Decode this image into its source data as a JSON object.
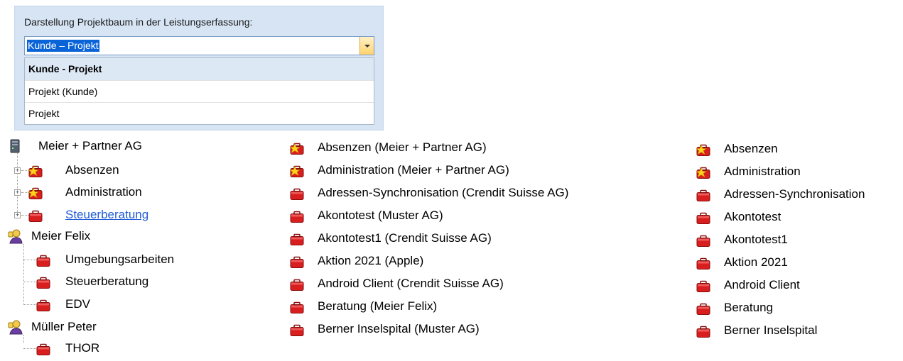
{
  "combo": {
    "label": "Darstellung Projektbaum in der Leistungserfassung:",
    "value": "Kunde – Projekt",
    "options": [
      "Kunde - Projekt",
      "Projekt (Kunde)",
      "Projekt"
    ]
  },
  "tree": {
    "root": "Meier + Partner AG",
    "root_children": [
      "Absenzen",
      "Administration",
      "Steuerberatung"
    ],
    "customer1": "Meier Felix",
    "customer1_children": [
      "Umgebungsarbeiten",
      "Steuerberatung",
      "EDV"
    ],
    "customer2": "Müller Peter",
    "customer2_children": [
      "THOR"
    ]
  },
  "list_with_customer": [
    "Absenzen (Meier + Partner AG)",
    "Administration (Meier + Partner AG)",
    "Adressen-Synchronisation (Crendit Suisse AG)",
    "Akontotest (Muster AG)",
    "Akontotest1 (Crendit Suisse AG)",
    "Aktion 2021 (Apple)",
    "Android Client (Crendit Suisse AG)",
    "Beratung (Meier Felix)",
    "Berner Inselspital (Muster AG)"
  ],
  "list_project_only": [
    "Absenzen",
    "Administration",
    "Adressen-Synchronisation",
    "Akontotest",
    "Akontotest1",
    "Aktion 2021",
    "Android Client",
    "Beratung",
    "Berner Inselspital"
  ]
}
